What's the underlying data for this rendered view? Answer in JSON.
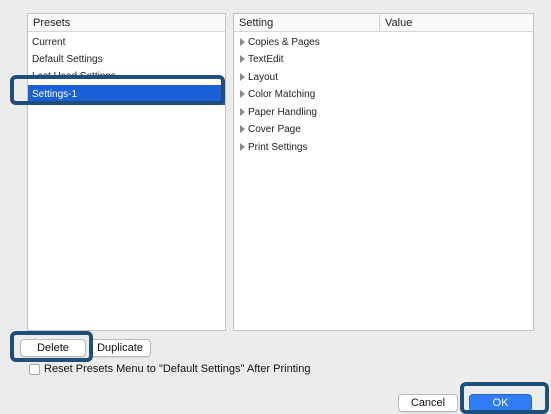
{
  "presets": {
    "header": "Presets",
    "items": [
      {
        "label": "Current"
      },
      {
        "label": "Default Settings"
      },
      {
        "label": "Last Used Settings"
      },
      {
        "label": "Settings-1"
      }
    ]
  },
  "settings_table": {
    "col_setting": "Setting",
    "col_value": "Value",
    "rows": [
      {
        "label": "Copies & Pages"
      },
      {
        "label": "TextEdit"
      },
      {
        "label": "Layout"
      },
      {
        "label": "Color Matching"
      },
      {
        "label": "Paper Handling"
      },
      {
        "label": "Cover Page"
      },
      {
        "label": "Print Settings"
      }
    ]
  },
  "buttons": {
    "delete": "Delete",
    "duplicate": "Duplicate",
    "cancel": "Cancel",
    "ok": "OK"
  },
  "reset_checkbox": {
    "label": "Reset Presets Menu to \"Default Settings\" After Printing",
    "checked": false
  },
  "colors": {
    "selection": "#1a5fd6",
    "highlight": "#1e4f7c",
    "primary_button": "#2f7cf6"
  }
}
